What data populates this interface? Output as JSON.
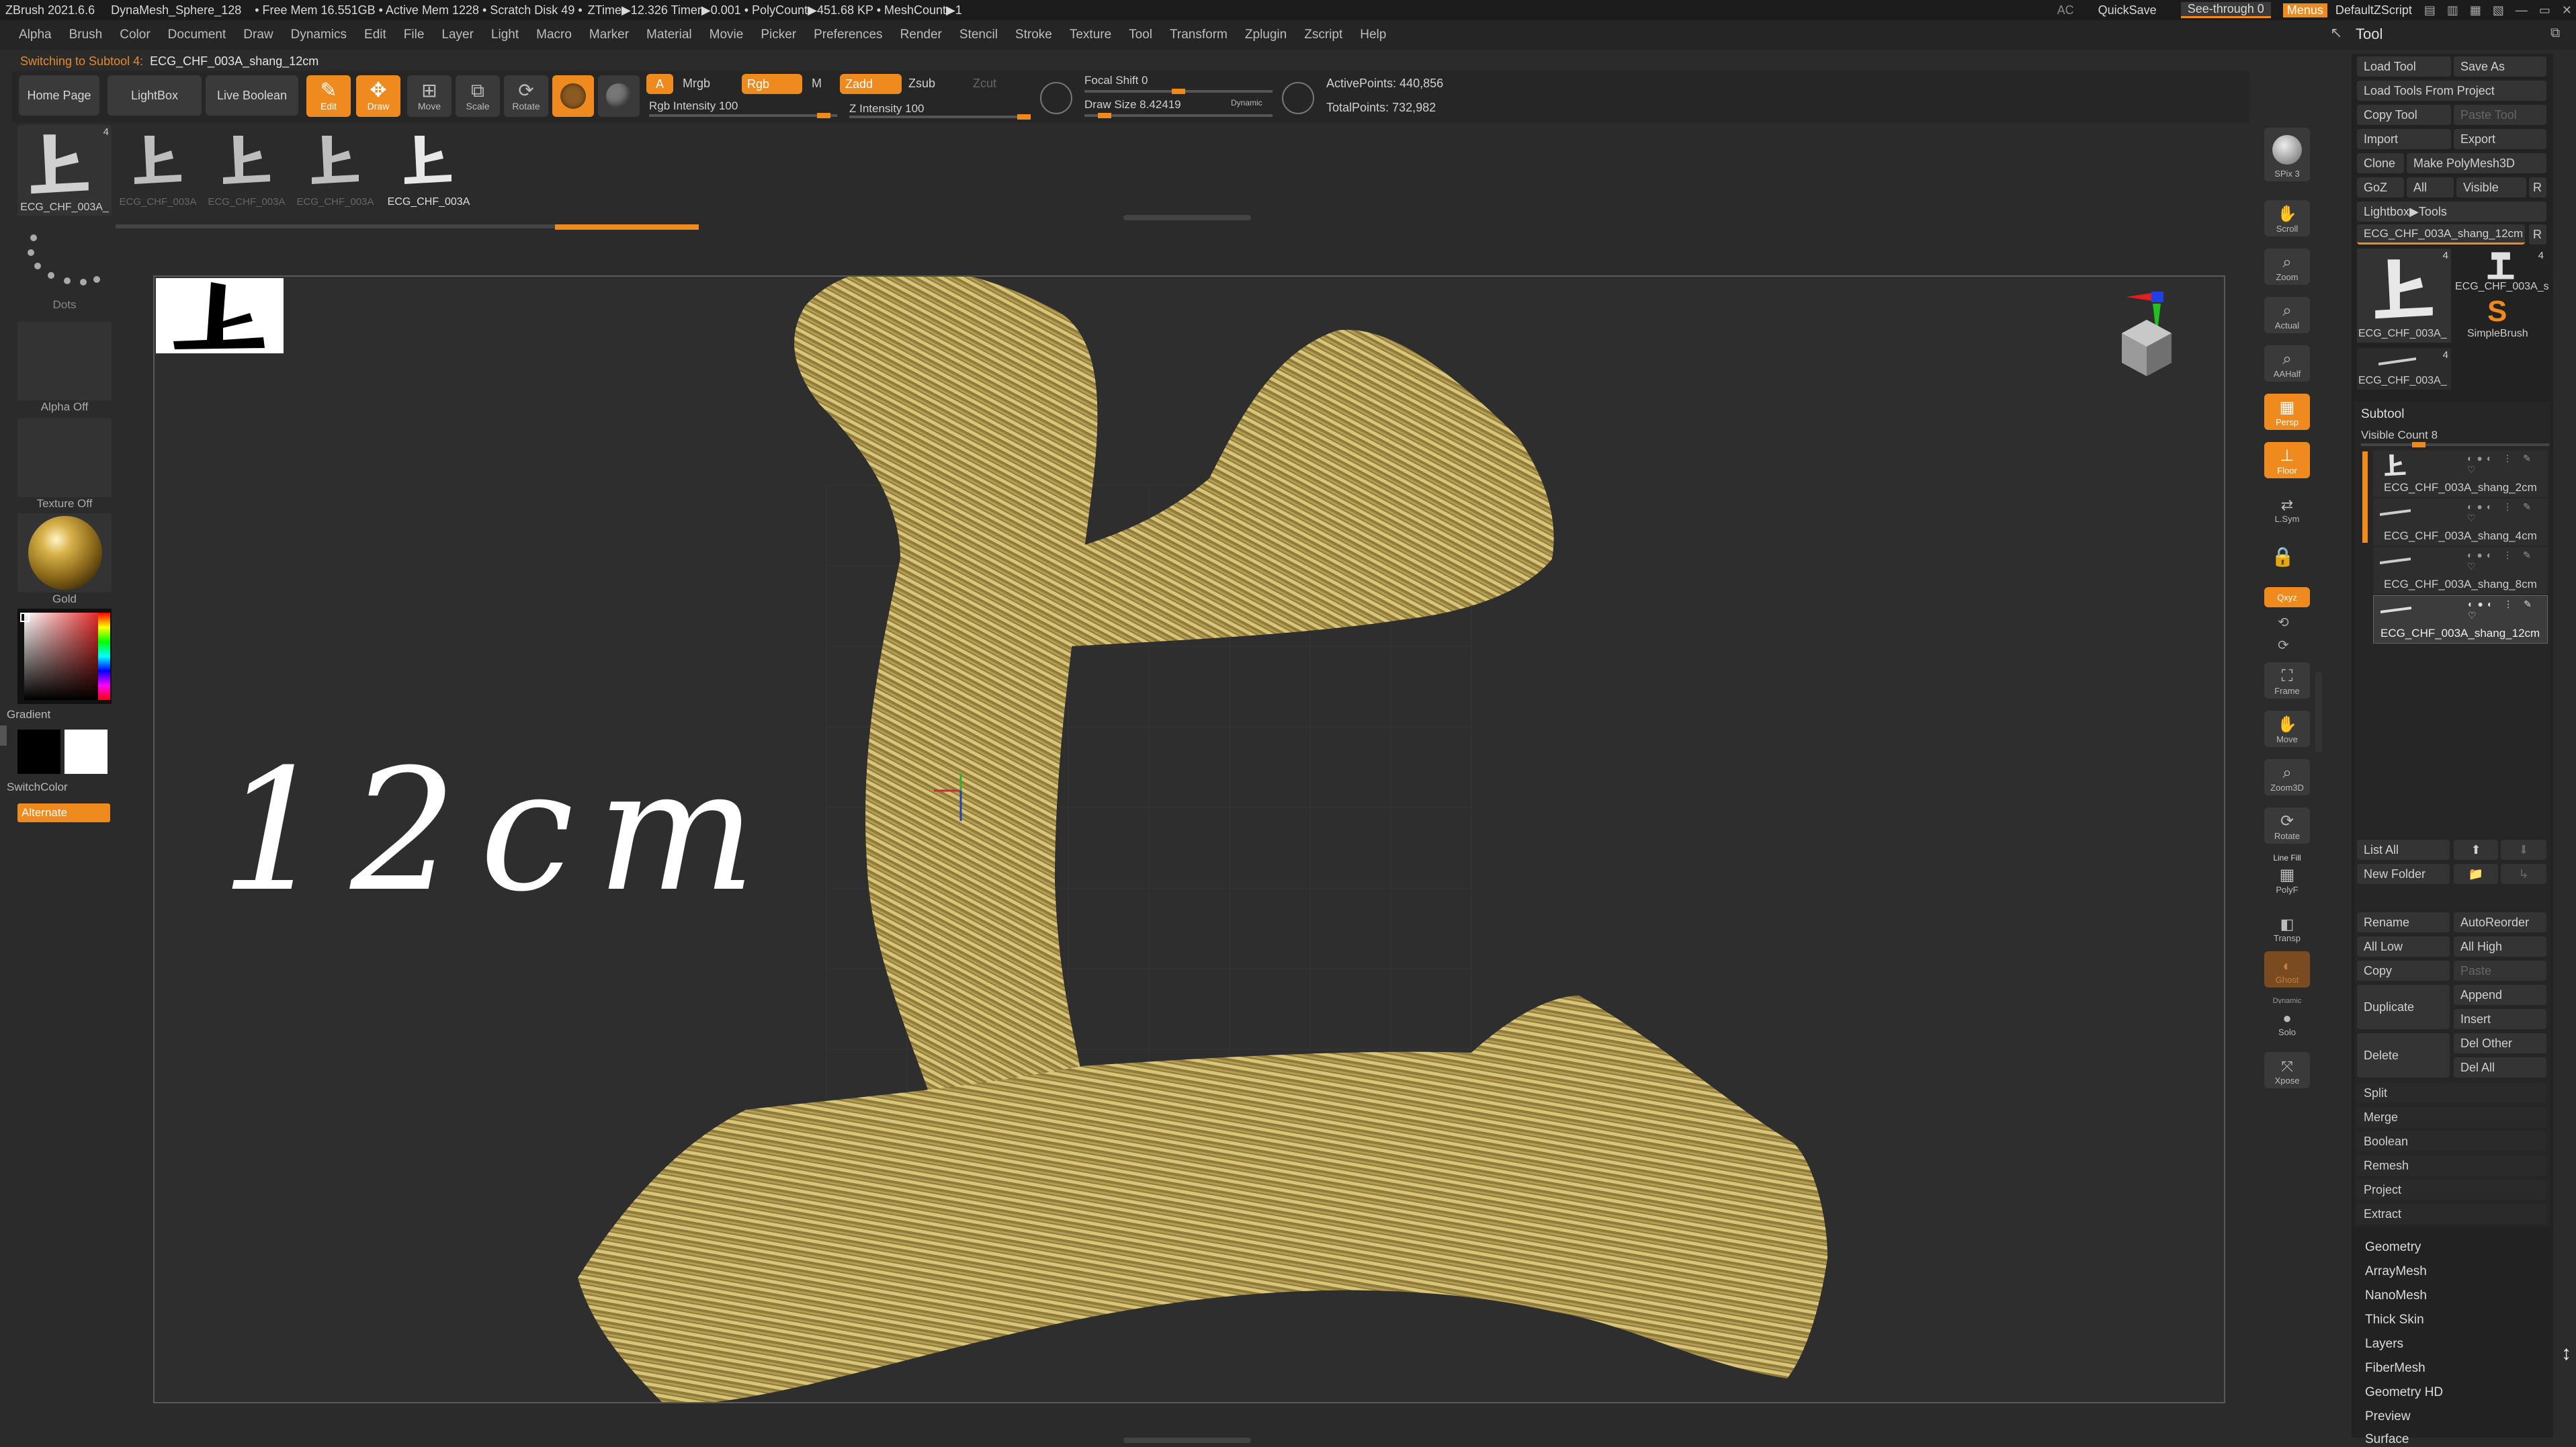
{
  "titlebar": {
    "items": [
      "ZBrush 2021.6.6",
      "DynaMesh_Sphere_128",
      "• Free Mem 16.551GB • Active Mem 1228 • Scratch Disk 49 •",
      "ZTime▶12.326 Timer▶0.001 • PolyCount▶451.68 KP • MeshCount▶1"
    ],
    "ac": "AC",
    "quicksave": "QuickSave",
    "see_through": "See-through  0",
    "menus": "Menus",
    "default_zscript": "DefaultZScript"
  },
  "menubar": [
    "Alpha",
    "Brush",
    "Color",
    "Document",
    "Draw",
    "Dynamics",
    "Edit",
    "File",
    "Layer",
    "Light",
    "Macro",
    "Marker",
    "Material",
    "Movie",
    "Picker",
    "Preferences",
    "Render",
    "Stencil",
    "Stroke",
    "Texture",
    "Tool",
    "Transform",
    "Zplugin",
    "Zscript",
    "Help"
  ],
  "notice": {
    "prefix": "Switching to Subtool 4:",
    "name": "ECG_CHF_003A_shang_12cm"
  },
  "toolbar": {
    "home_page": "Home Page",
    "lightbox": "LightBox",
    "live_boolean": "Live Boolean",
    "edit": "Edit",
    "draw": "Draw",
    "move": "Move",
    "scale": "Scale",
    "rotate": "Rotate",
    "a": "A",
    "mrgb": "Mrgb",
    "rgb": "Rgb",
    "m": "M",
    "zadd": "Zadd",
    "zsub": "Zsub",
    "zcut": "Zcut",
    "rgb_intensity": "Rgb Intensity 100",
    "z_intensity": "Z Intensity 100",
    "focal_shift": "Focal Shift 0",
    "draw_size": "Draw Size 8.42419",
    "dynamic": "Dynamic",
    "active_points": "ActivePoints: 440,856",
    "total_points": "TotalPoints: 732,982"
  },
  "tool_thumbs": [
    "ECG_CHF_003A",
    "ECG_CHF_003A",
    "ECG_CHF_003A",
    "ECG_CHF_003A"
  ],
  "left_shelf": {
    "tool_name": "ECG_CHF_003A_",
    "tool_count": "4",
    "dots": "Dots",
    "alpha": "Alpha Off",
    "texture": "Texture Off",
    "material": "Gold",
    "gradient": "Gradient",
    "switch_color": "SwitchColor",
    "alternate": "Alternate"
  },
  "canvas": {
    "label": "12cm"
  },
  "right_shelf": [
    "SPix 3",
    "Scroll",
    "Zoom",
    "Actual",
    "AAHalf",
    "Persp",
    "Floor",
    "L.Sym",
    "Qxyz",
    "Frame",
    "Move",
    "Zoom3D",
    "Rotate",
    "Line Fill",
    "PolyF",
    "Transp",
    "Ghost",
    "Dynamic",
    "Solo",
    "Xpose"
  ],
  "tool_palette": {
    "title": "Tool",
    "load_tool": "Load Tool",
    "save_as": "Save As",
    "load_from_project": "Load Tools From Project",
    "copy_tool": "Copy Tool",
    "paste_tool": "Paste Tool",
    "import": "Import",
    "export": "Export",
    "clone": "Clone",
    "make_polymesh": "Make PolyMesh3D",
    "goz": "GoZ",
    "all": "All",
    "visible": "Visible",
    "r": "R",
    "lightbox_tools": "Lightbox▶Tools",
    "current_tool": "ECG_CHF_003A_shang_12cm",
    "thumbs": [
      {
        "name": "ECG_CHF_003A_",
        "count": "4"
      },
      {
        "name": "ECG_CHF_003A_s",
        "count": "4"
      },
      {
        "name": "SimpleBrush",
        "count": ""
      },
      {
        "name": "ECG_CHF_003A_",
        "count": "4"
      }
    ],
    "subtool": "Subtool",
    "visible_count": "Visible Count 8",
    "subtools": [
      "ECG_CHF_003A_shang_2cm",
      "ECG_CHF_003A_shang_4cm",
      "ECG_CHF_003A_shang_8cm",
      "ECG_CHF_003A_shang_12cm"
    ],
    "list_all": "List All",
    "new_folder": "New Folder",
    "rename": "Rename",
    "auto_reorder": "AutoReorder",
    "all_low": "All Low",
    "all_high": "All High",
    "copy": "Copy",
    "paste": "Paste",
    "duplicate": "Duplicate",
    "append": "Append",
    "insert": "Insert",
    "delete": "Delete",
    "del_other": "Del Other",
    "del_all": "Del All",
    "subtool_menu": [
      "Split",
      "Merge",
      "Boolean",
      "Remesh",
      "Project",
      "Extract"
    ],
    "sections": [
      "Geometry",
      "ArrayMesh",
      "NanoMesh",
      "Thick Skin",
      "Layers",
      "FiberMesh",
      "Geometry HD",
      "Preview",
      "Surface"
    ]
  },
  "colors": {
    "accent": "#ee8a1e",
    "mesh": "#c9b261",
    "background": "#2b2b2b"
  }
}
